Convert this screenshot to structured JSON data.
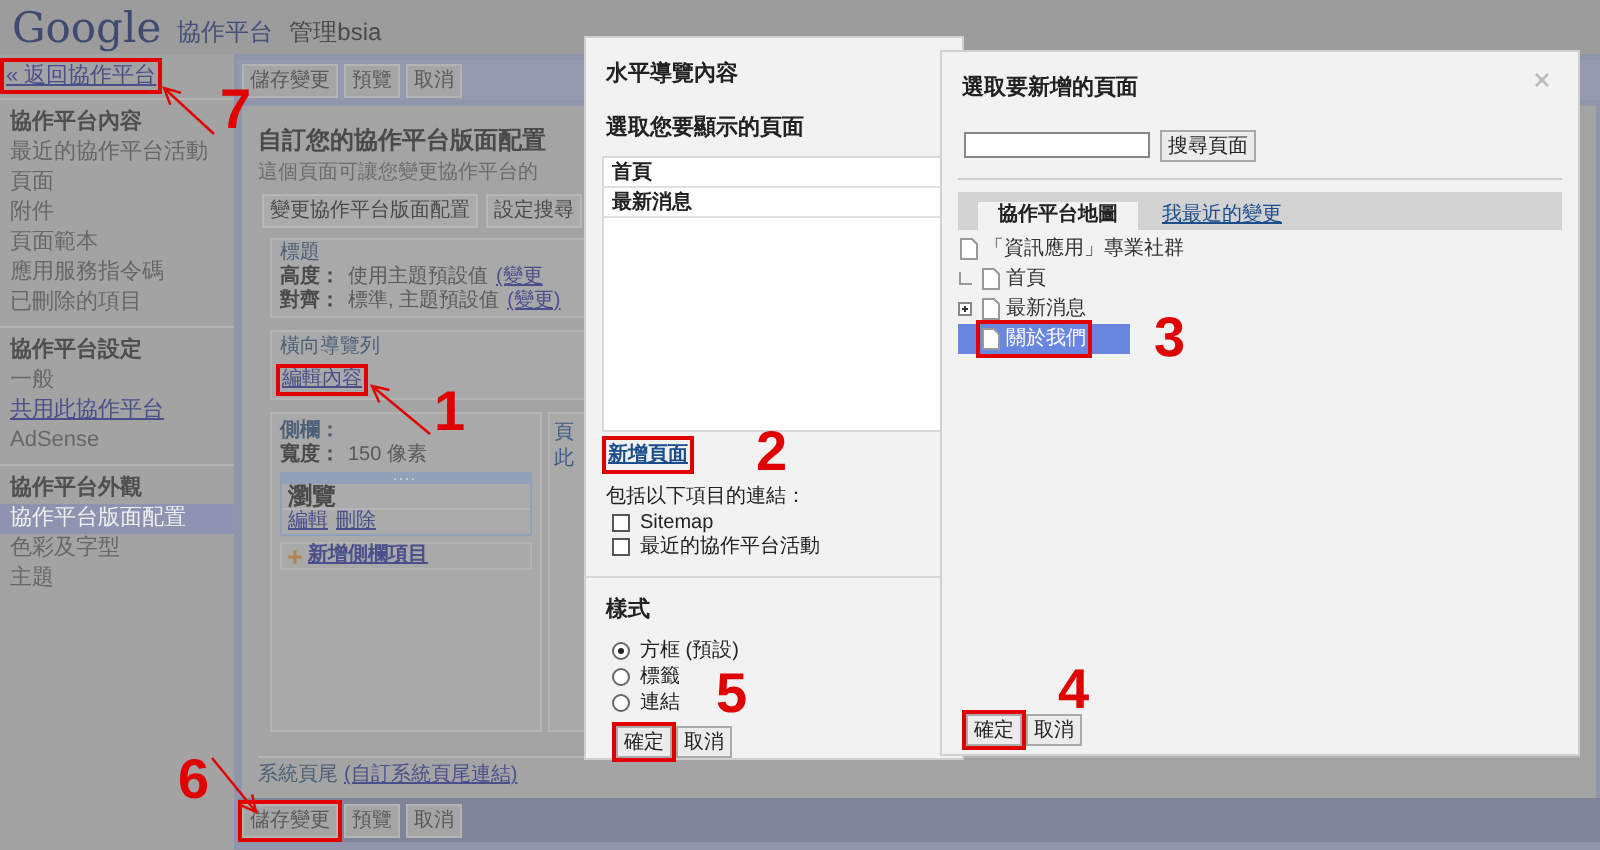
{
  "header": {
    "logo": "Google",
    "product": "協作平台",
    "site": "管理bsia"
  },
  "sidebar": {
    "back_link": {
      "label": "« 返回協作平台",
      "highlighted": true
    },
    "sections": [
      {
        "title": "協作平台內容",
        "items": [
          {
            "label": "最近的協作平台活動",
            "kind": "text",
            "selected": false
          },
          {
            "label": "頁面",
            "kind": "text",
            "selected": false
          },
          {
            "label": "附件",
            "kind": "text",
            "selected": false
          },
          {
            "label": "頁面範本",
            "kind": "text",
            "selected": false
          },
          {
            "label": "應用服務指令碼",
            "kind": "text",
            "selected": false
          },
          {
            "label": "已刪除的項目",
            "kind": "text",
            "selected": false
          }
        ]
      },
      {
        "title": "協作平台設定",
        "items": [
          {
            "label": "一般",
            "kind": "text",
            "selected": false
          },
          {
            "label": "共用此協作平台",
            "kind": "link",
            "selected": false
          },
          {
            "label": "AdSense",
            "kind": "text",
            "selected": false
          }
        ]
      },
      {
        "title": "協作平台外觀",
        "items": [
          {
            "label": "協作平台版面配置",
            "kind": "text",
            "selected": true
          },
          {
            "label": "色彩及字型",
            "kind": "text",
            "selected": false
          },
          {
            "label": "主題",
            "kind": "text",
            "selected": false
          }
        ]
      }
    ]
  },
  "toolbar_top": [
    {
      "label": "儲存變更",
      "highlighted": false
    },
    {
      "label": "預覽",
      "highlighted": false
    },
    {
      "label": "取消",
      "highlighted": false
    }
  ],
  "layout": {
    "title": "自訂您的協作平台版面配置",
    "description": "這個頁面可讓您變更協作平台的",
    "buttons": [
      "變更協作平台版面配置",
      "設定搜尋"
    ],
    "header_section": {
      "title": "標題",
      "rows": [
        {
          "label": "高度：",
          "value": "使用主題預設值",
          "link": "(變更"
        },
        {
          "label": "對齊：",
          "value": "標準, 主題預設值",
          "link": "(變更)"
        }
      ]
    },
    "nav_section": {
      "title": "橫向導覽列",
      "link": {
        "label": "編輯內容",
        "highlighted": true
      }
    },
    "sidebar_section": {
      "title": "側欄：",
      "width_label": "寬度：",
      "width_value": "150 像素",
      "widget": {
        "title": "瀏覽",
        "links": [
          "編輯",
          "刪除"
        ]
      },
      "add_link": "新增側欄項目"
    },
    "page_column": [
      "頁",
      "此"
    ],
    "footer": {
      "label": "系統頁尾",
      "link": "(自訂系統頁尾連結)"
    }
  },
  "toolbar_bottom": [
    {
      "label": "儲存變更",
      "highlighted": true
    },
    {
      "label": "預覽",
      "highlighted": false
    },
    {
      "label": "取消",
      "highlighted": false
    }
  ],
  "nav_dialog": {
    "title": "水平導覽內容",
    "subtitle": "選取您要顯示的頁面",
    "pages": [
      "首頁",
      "最新消息"
    ],
    "add_link": {
      "label": "新增頁面",
      "highlighted": true
    },
    "include_label": "包括以下項目的連結：",
    "checkboxes": [
      {
        "label": "Sitemap",
        "checked": false
      },
      {
        "label": "最近的協作平台活動",
        "checked": false
      }
    ],
    "style_title": "樣式",
    "styles": [
      {
        "label": "方框 (預設)",
        "selected": true
      },
      {
        "label": "標籤",
        "selected": false
      },
      {
        "label": "連結",
        "selected": false
      }
    ],
    "buttons": [
      {
        "label": "確定",
        "highlighted": true
      },
      {
        "label": "取消",
        "highlighted": false
      }
    ]
  },
  "page_picker": {
    "title": "選取要新增的頁面",
    "search_button": "搜尋頁面",
    "tabs": [
      {
        "label": "協作平台地圖",
        "selected": true
      },
      {
        "label": "我最近的變更",
        "selected": false
      }
    ],
    "tree": [
      {
        "label": "「資訊應用」專業社群",
        "selected": false,
        "highlighted": false,
        "children": [
          {
            "label": "首頁",
            "selected": false,
            "highlighted": false
          },
          {
            "label": "最新消息",
            "selected": false,
            "highlighted": false,
            "expanded": false
          },
          {
            "label": "關於我們",
            "selected": true,
            "highlighted": true
          }
        ]
      }
    ],
    "buttons": [
      {
        "label": "確定",
        "highlighted": true
      },
      {
        "label": "取消",
        "highlighted": false
      }
    ]
  },
  "annotations": [
    {
      "number": "7"
    },
    {
      "number": "1"
    },
    {
      "number": "2"
    },
    {
      "number": "3"
    },
    {
      "number": "4"
    },
    {
      "number": "5"
    },
    {
      "number": "6"
    }
  ]
}
